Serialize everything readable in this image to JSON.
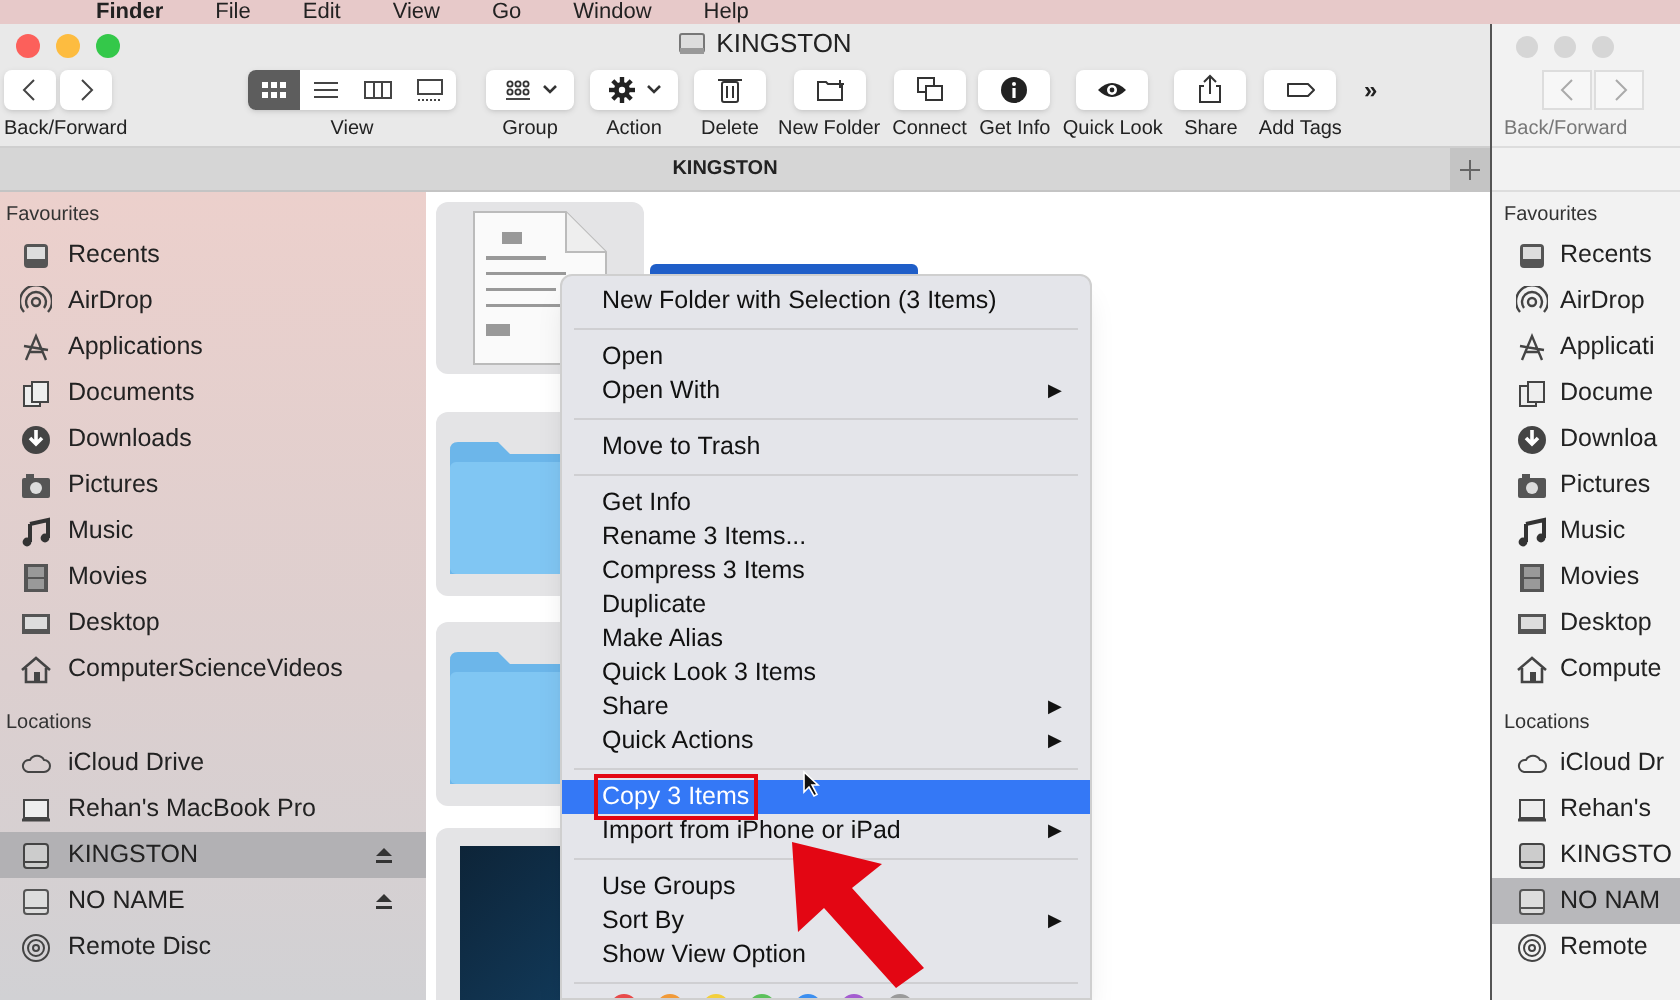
{
  "menu_bar": [
    "Finder",
    "File",
    "Edit",
    "View",
    "Go",
    "Window",
    "Help"
  ],
  "window": {
    "title": "KINGSTON",
    "toolbar": [
      {
        "kind": "nav",
        "label": "Back/Forward"
      },
      {
        "kind": "view",
        "label": "View",
        "segments": [
          {
            "selected": true
          },
          {
            "selected": false
          },
          {
            "selected": false
          },
          {
            "selected": false
          }
        ]
      },
      {
        "kind": "dropdown",
        "label": "Group"
      },
      {
        "kind": "dropdown",
        "label": "Action"
      },
      {
        "kind": "button",
        "label": "Delete"
      },
      {
        "kind": "button",
        "label": "New Folder"
      },
      {
        "kind": "button",
        "label": "Connect"
      },
      {
        "kind": "button",
        "label": "Get Info"
      },
      {
        "kind": "button",
        "label": "Quick Look"
      },
      {
        "kind": "button",
        "label": "Share"
      },
      {
        "kind": "button",
        "label": "Add Tags"
      },
      {
        "kind": "overflow",
        "label": "»"
      }
    ],
    "tab": "KINGSTON",
    "sidebar": [
      {
        "heading": "Favourites",
        "items": [
          {
            "label": "Recents",
            "selected": false,
            "eject": false
          },
          {
            "label": "AirDrop",
            "selected": false,
            "eject": false
          },
          {
            "label": "Applications",
            "selected": false,
            "eject": false
          },
          {
            "label": "Documents",
            "selected": false,
            "eject": false
          },
          {
            "label": "Downloads",
            "selected": false,
            "eject": false
          },
          {
            "label": "Pictures",
            "selected": false,
            "eject": false
          },
          {
            "label": "Music",
            "selected": false,
            "eject": false
          },
          {
            "label": "Movies",
            "selected": false,
            "eject": false
          },
          {
            "label": "Desktop",
            "selected": false,
            "eject": false
          },
          {
            "label": "ComputerScienceVideos",
            "selected": false,
            "eject": false
          }
        ]
      },
      {
        "heading": "Locations",
        "items": [
          {
            "label": "iCloud Drive",
            "selected": false,
            "eject": false
          },
          {
            "label": "Rehan's MacBook Pro",
            "selected": false,
            "eject": false
          },
          {
            "label": "KINGSTON",
            "selected": true,
            "eject": true
          },
          {
            "label": "NO NAME",
            "selected": false,
            "eject": true
          },
          {
            "label": "Remote Disc",
            "selected": false,
            "eject": false
          }
        ]
      }
    ]
  },
  "context_menu": {
    "groups": [
      [
        {
          "label": "New Folder with Selection (3 Items)",
          "submenu": false,
          "selected": false
        }
      ],
      [
        {
          "label": "Open",
          "submenu": false,
          "selected": false
        },
        {
          "label": "Open With",
          "submenu": true,
          "selected": false
        }
      ],
      [
        {
          "label": "Move to Trash",
          "submenu": false,
          "selected": false
        }
      ],
      [
        {
          "label": "Get Info",
          "submenu": false,
          "selected": false
        },
        {
          "label": "Rename 3 Items...",
          "submenu": false,
          "selected": false
        },
        {
          "label": "Compress 3 Items",
          "submenu": false,
          "selected": false
        },
        {
          "label": "Duplicate",
          "submenu": false,
          "selected": false
        },
        {
          "label": "Make Alias",
          "submenu": false,
          "selected": false
        },
        {
          "label": "Quick Look 3 Items",
          "submenu": false,
          "selected": false
        },
        {
          "label": "Share",
          "submenu": true,
          "selected": false
        },
        {
          "label": "Quick Actions",
          "submenu": true,
          "selected": false
        }
      ],
      [
        {
          "label": "Copy 3 Items",
          "submenu": false,
          "selected": true
        },
        {
          "label": "Import from iPhone or iPad",
          "submenu": true,
          "selected": false
        }
      ],
      [
        {
          "label": "Use Groups",
          "submenu": false,
          "selected": false
        },
        {
          "label": "Sort By",
          "submenu": true,
          "selected": false
        },
        {
          "label": "Show View Option",
          "submenu": false,
          "selected": false
        }
      ]
    ],
    "submenu_mark": "▶",
    "tag_colors": [
      {
        "color": "#e84a4a"
      },
      {
        "color": "#f19a38"
      },
      {
        "color": "#f3cf3c"
      },
      {
        "color": "#5bc05b"
      },
      {
        "color": "#3c8ff0"
      },
      {
        "color": "#a45dd0"
      },
      {
        "color": "#9a9a9a"
      }
    ]
  },
  "second_window": {
    "toolbar_label": "Back/Forward",
    "sidebar": [
      {
        "heading": "Favourites",
        "items": [
          {
            "label": "Recents",
            "selected": false
          },
          {
            "label": "AirDrop",
            "selected": false
          },
          {
            "label": "Applicati",
            "selected": false
          },
          {
            "label": "Docume",
            "selected": false
          },
          {
            "label": "Downloa",
            "selected": false
          },
          {
            "label": "Pictures",
            "selected": false
          },
          {
            "label": "Music",
            "selected": false
          },
          {
            "label": "Movies",
            "selected": false
          },
          {
            "label": "Desktop",
            "selected": false
          },
          {
            "label": "Compute",
            "selected": false
          }
        ]
      },
      {
        "heading": "Locations",
        "items": [
          {
            "label": "iCloud Dr",
            "selected": false
          },
          {
            "label": "Rehan's",
            "selected": false
          },
          {
            "label": "KINGSTO",
            "selected": false
          },
          {
            "label": "NO NAM",
            "selected": true
          },
          {
            "label": "Remote",
            "selected": false
          }
        ]
      }
    ]
  }
}
